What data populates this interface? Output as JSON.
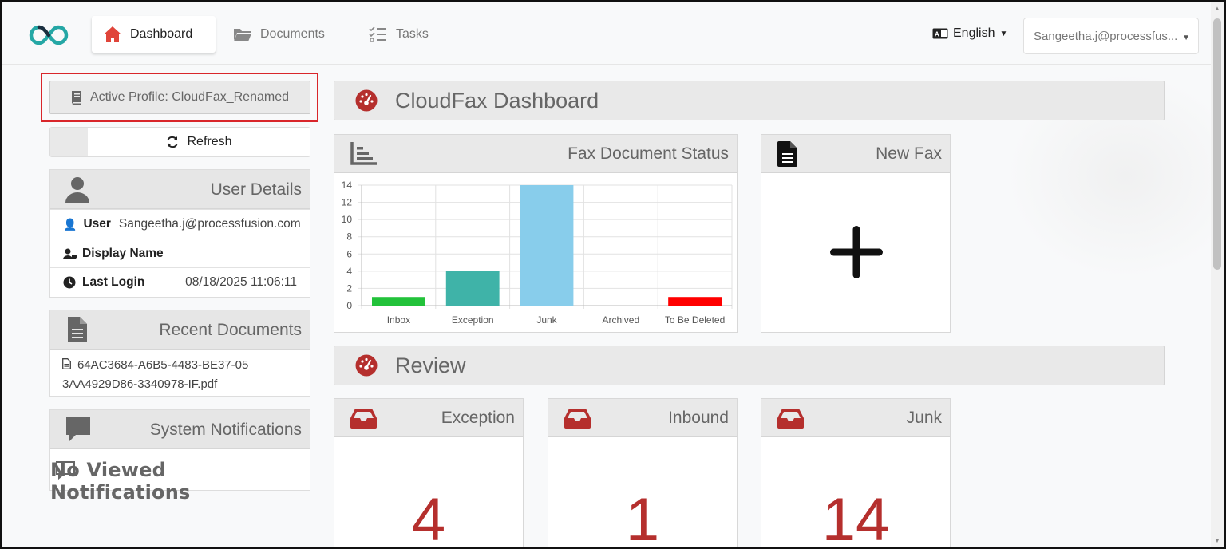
{
  "navbar": {
    "tabs": [
      {
        "label": "Dashboard",
        "icon": "home-icon",
        "active": true
      },
      {
        "label": "Documents",
        "icon": "folder-icon"
      },
      {
        "label": "Tasks",
        "icon": "tasks-list-icon"
      }
    ],
    "language": "English",
    "user_account": "Sangeetha.j@processfus..."
  },
  "sidebar": {
    "active_profile": "Active Profile: CloudFax_Renamed",
    "refresh_label": "Refresh",
    "user_details": {
      "title": "User Details",
      "user_label": "User",
      "user_value": "Sangeetha.j@processfusion.com",
      "display_name_label": "Display Name",
      "last_login_label": "Last Login",
      "last_login_value": "08/18/2025 11:06:11"
    },
    "recent_documents": {
      "title": "Recent Documents",
      "items": [
        "64AC3684-A6B5-4483-BE37-053AA4929D86-3340978-IF.pdf"
      ]
    },
    "system_notifications": {
      "title": "System Notifications",
      "empty_text": "No Viewed Notifications"
    }
  },
  "main": {
    "dashboard_title": "CloudFax Dashboard",
    "fax_status_title": "Fax Document Status",
    "new_fax_title": "New Fax",
    "review_title": "Review",
    "review_cards": [
      {
        "title": "Exception",
        "count": "4"
      },
      {
        "title": "Inbound",
        "count": "1"
      },
      {
        "title": "Junk",
        "count": "14"
      }
    ]
  },
  "chart_data": {
    "type": "bar",
    "categories": [
      "Inbox",
      "Exception",
      "Junk",
      "Archived",
      "To Be Deleted"
    ],
    "values": [
      1,
      4,
      14,
      0,
      1
    ],
    "colors": [
      "#22c23a",
      "#3fb3a8",
      "#88cdeb",
      "#cccccc",
      "#ff0000"
    ],
    "ylim": [
      0,
      14
    ],
    "yticks": [
      0,
      2,
      4,
      6,
      8,
      10,
      12,
      14
    ],
    "grid": true
  },
  "colors": {
    "accent_red": "#b52f2d",
    "brand_teal": "#25a7a5",
    "highlight_border": "#d9262b"
  }
}
